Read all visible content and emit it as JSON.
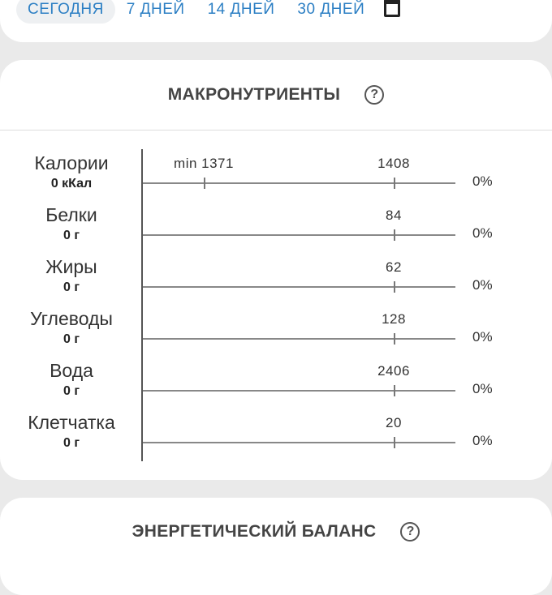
{
  "range_tabs": [
    {
      "label": "СЕГОДНЯ",
      "selected": true
    },
    {
      "label": "7 ДНЕЙ",
      "selected": false
    },
    {
      "label": "14 ДНЕЙ",
      "selected": false
    },
    {
      "label": "30 ДНЕЙ",
      "selected": false
    }
  ],
  "calendar_icon": "calendar-icon",
  "macros": {
    "title": "МАКРОНУТРИЕНТЫ",
    "help_icon": "?",
    "rows": [
      {
        "name": "Калории",
        "amount": "0 кКал",
        "min_label": "min 1371",
        "target_label": "1408",
        "min_value": 1371,
        "target_value": 1408,
        "percent": "0%"
      },
      {
        "name": "Белки",
        "amount": "0 г",
        "target_label": "84",
        "target_value": 84,
        "percent": "0%"
      },
      {
        "name": "Жиры",
        "amount": "0 г",
        "target_label": "62",
        "target_value": 62,
        "percent": "0%"
      },
      {
        "name": "Углеводы",
        "amount": "0 г",
        "target_label": "128",
        "target_value": 128,
        "percent": "0%"
      },
      {
        "name": "Вода",
        "amount": "0 г",
        "target_label": "2406",
        "target_value": 2406,
        "percent": "0%"
      },
      {
        "name": "Клетчатка",
        "amount": "0 г",
        "target_label": "20",
        "target_value": 20,
        "percent": "0%"
      }
    ]
  },
  "energy": {
    "title": "ЭНЕРГЕТИЧЕСКИЙ БАЛАНС",
    "help_icon": "?"
  },
  "colors": {
    "accent": "#2c7fc4",
    "background": "#eaeaea",
    "card": "#ffffff"
  }
}
